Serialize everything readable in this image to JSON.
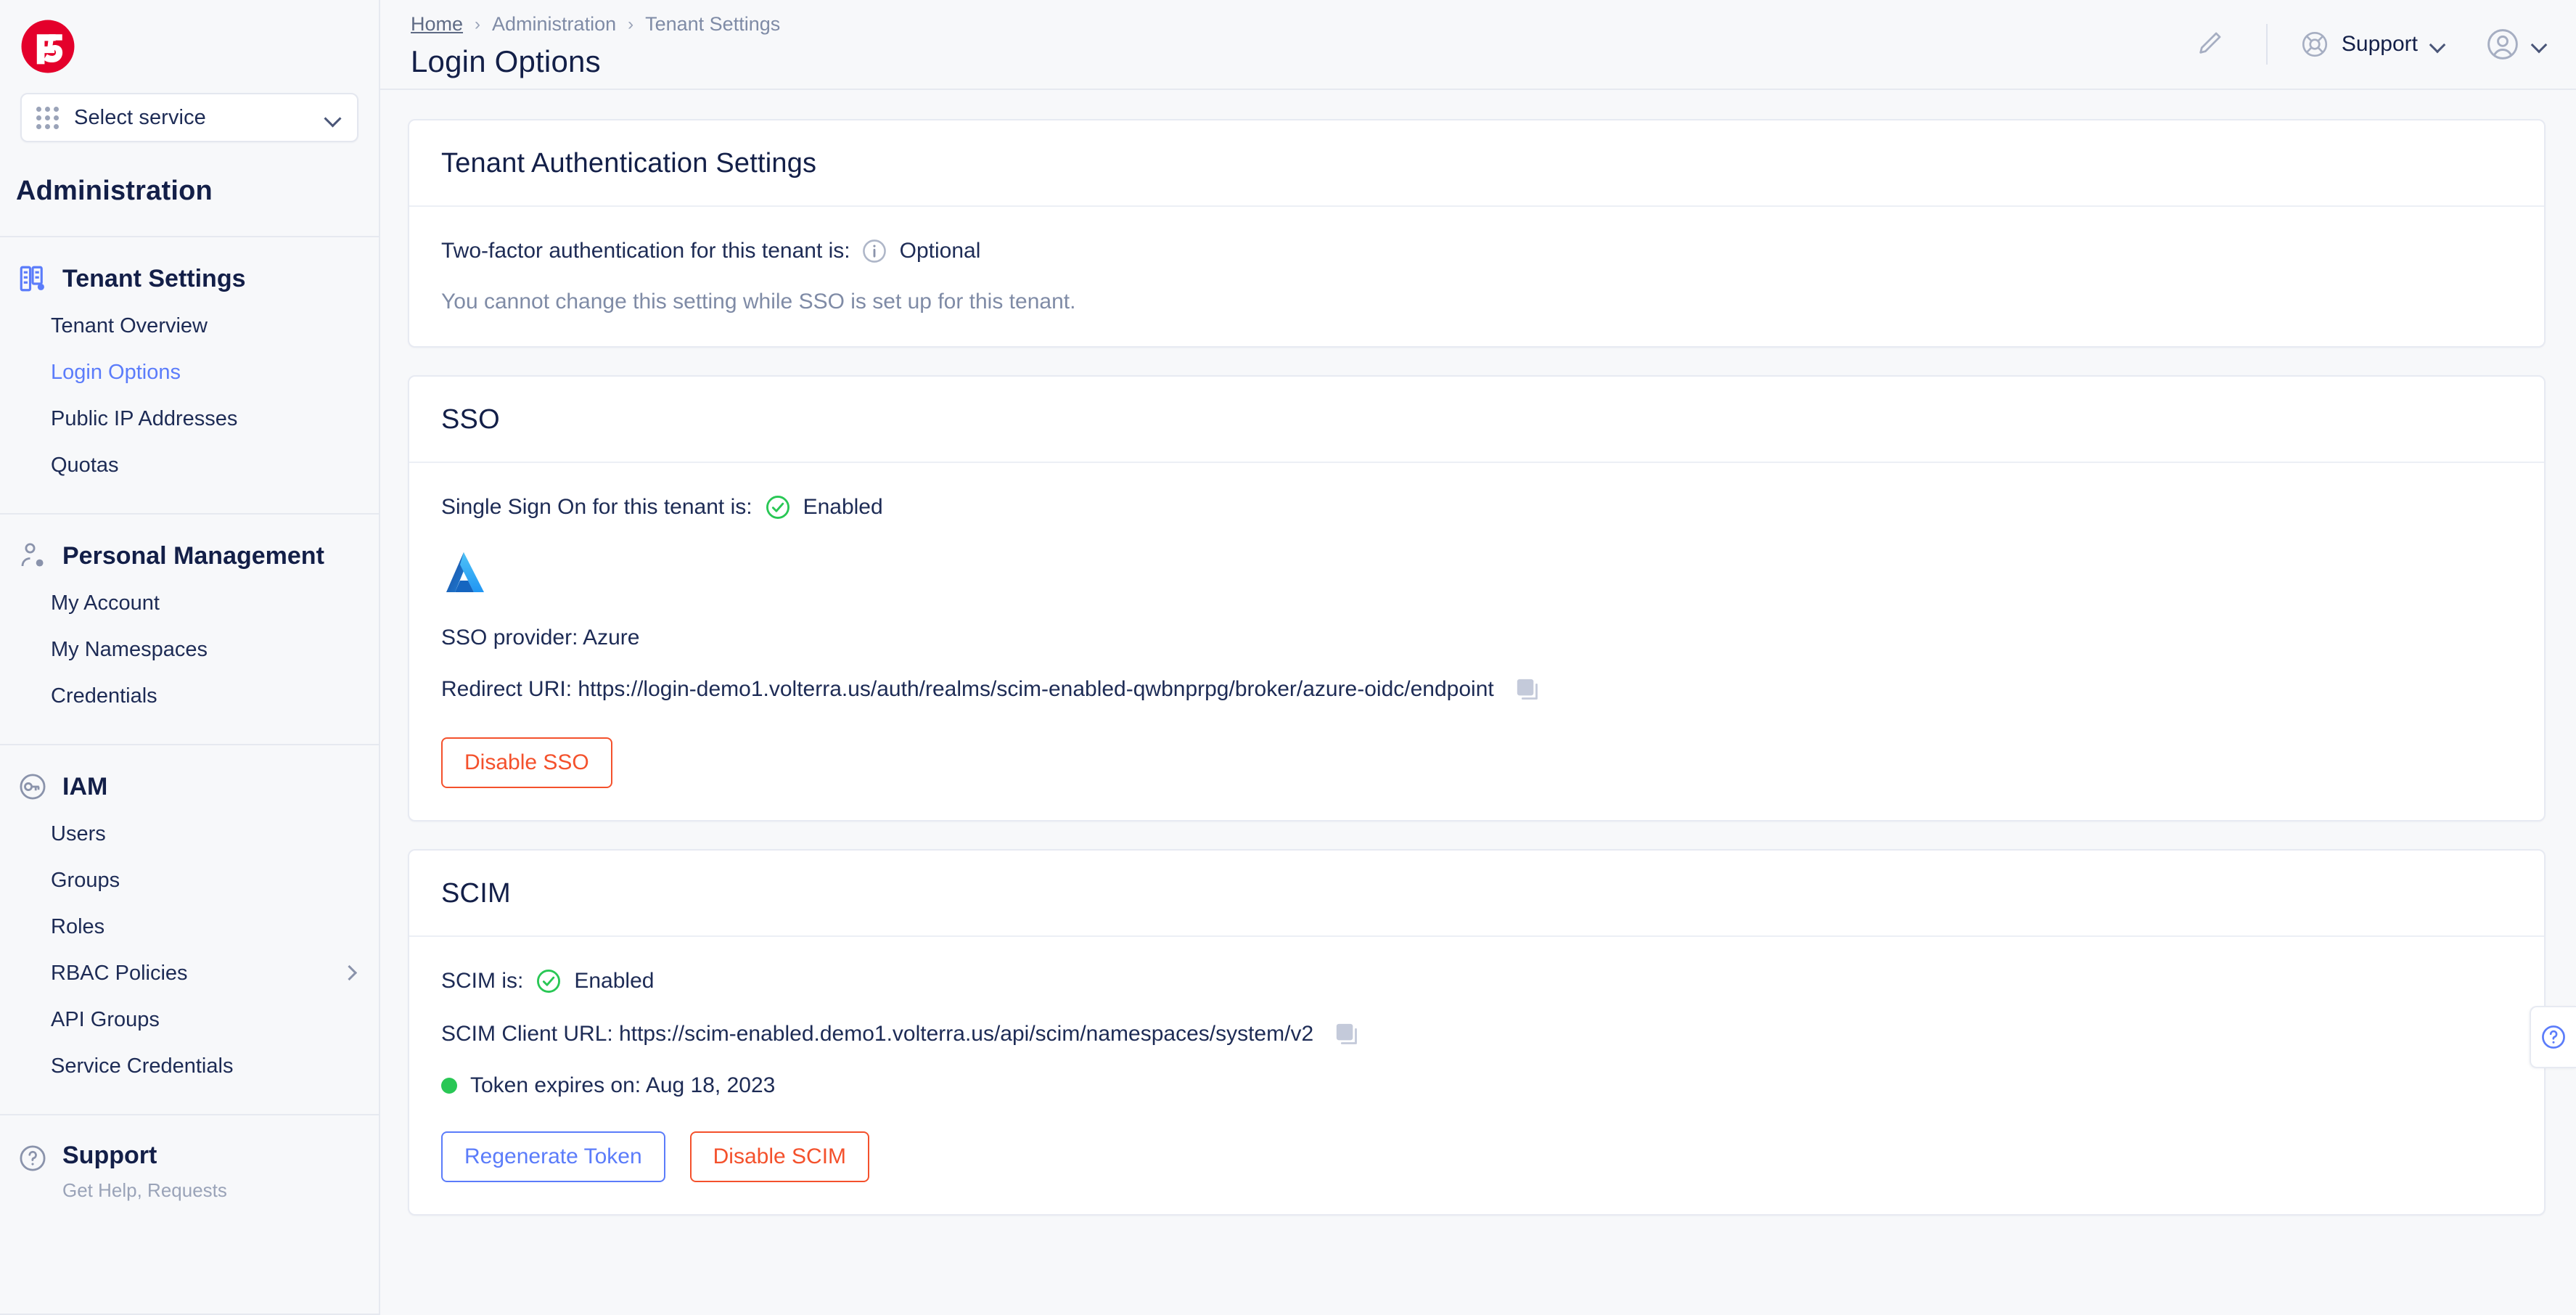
{
  "sidebar": {
    "logo_alt": "f5-logo",
    "service_selector": {
      "label": "Select service"
    },
    "title": "Administration",
    "groups": [
      {
        "icon": "tenant-settings-icon",
        "title": "Tenant Settings",
        "items": [
          {
            "label": "Tenant Overview",
            "active": false,
            "has_chevron": false
          },
          {
            "label": "Login Options",
            "active": true,
            "has_chevron": false
          },
          {
            "label": "Public IP Addresses",
            "active": false,
            "has_chevron": false
          },
          {
            "label": "Quotas",
            "active": false,
            "has_chevron": false
          }
        ]
      },
      {
        "icon": "personal-management-icon",
        "title": "Personal Management",
        "items": [
          {
            "label": "My Account",
            "active": false,
            "has_chevron": false
          },
          {
            "label": "My Namespaces",
            "active": false,
            "has_chevron": false
          },
          {
            "label": "Credentials",
            "active": false,
            "has_chevron": false
          }
        ]
      },
      {
        "icon": "iam-key-icon",
        "title": "IAM",
        "items": [
          {
            "label": "Users",
            "active": false,
            "has_chevron": false
          },
          {
            "label": "Groups",
            "active": false,
            "has_chevron": false
          },
          {
            "label": "Roles",
            "active": false,
            "has_chevron": false
          },
          {
            "label": "RBAC Policies",
            "active": false,
            "has_chevron": true
          },
          {
            "label": "API Groups",
            "active": false,
            "has_chevron": false
          },
          {
            "label": "Service Credentials",
            "active": false,
            "has_chevron": false
          }
        ]
      }
    ],
    "support": {
      "title": "Support",
      "subtitle": "Get Help, Requests",
      "icon": "question-circle-icon"
    }
  },
  "topbar": {
    "breadcrumb": [
      "Home",
      "Administration",
      "Tenant Settings"
    ],
    "separator": "›",
    "page_title": "Login Options",
    "pencil_icon": "pencil-icon",
    "support_label": "Support",
    "support_icon": "lifebuoy-icon",
    "avatar_icon": "user-avatar-icon"
  },
  "cards": {
    "tenant_auth": {
      "heading": "Tenant Authentication Settings",
      "two_factor_label": "Two-factor authentication for this tenant is:",
      "two_factor_value": "Optional",
      "note": "You cannot change this setting while SSO is set up for this tenant."
    },
    "sso": {
      "heading": "SSO",
      "status_label": "Single Sign On for this tenant is:",
      "status_value": "Enabled",
      "provider_logo": "azure-logo",
      "provider_label": "SSO provider: Azure",
      "redirect_label": "Redirect URI: https://login-demo1.volterra.us/auth/realms/scim-enabled-qwbnprpg/broker/azure-oidc/endpoint",
      "copy_icon": "copy-icon",
      "disable_button": "Disable SSO"
    },
    "scim": {
      "heading": "SCIM",
      "status_label": "SCIM is:",
      "status_value": "Enabled",
      "client_url_label": "SCIM Client URL: https://scim-enabled.demo1.volterra.us/api/scim/namespaces/system/v2",
      "copy_icon": "copy-icon",
      "token_expiry": "Token expires on: Aug 18, 2023",
      "regenerate_button": "Regenerate Token",
      "disable_button": "Disable SCIM"
    }
  },
  "help_fab": {
    "icon": "help-question-icon"
  },
  "colors": {
    "brand_red": "#e4002b",
    "accent_blue": "#5b7cfa",
    "danger": "#f4512c",
    "success": "#29c755",
    "text_dark": "#131f48",
    "muted": "#7f8ba6"
  }
}
